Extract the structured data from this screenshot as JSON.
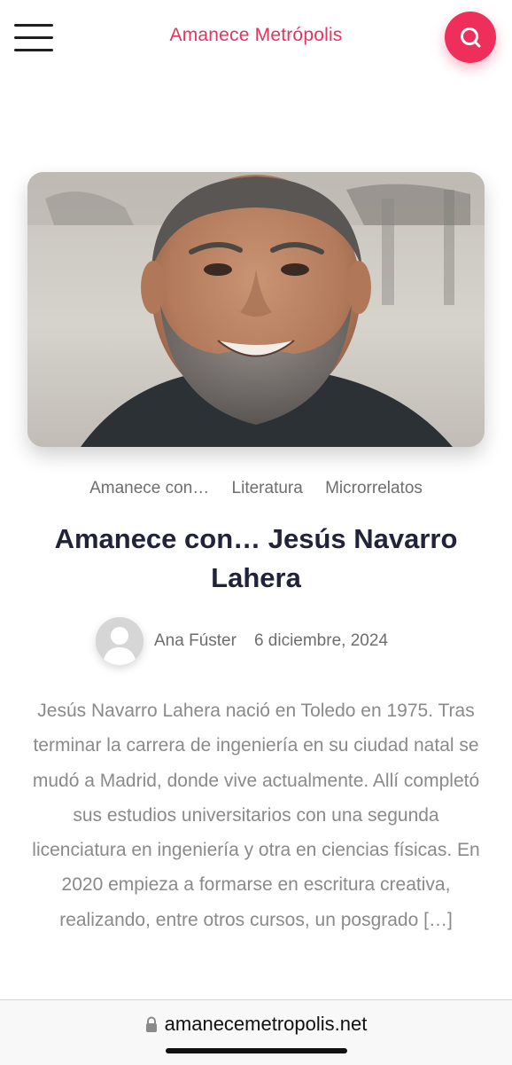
{
  "header": {
    "site_title": "Amanece Metrópolis",
    "menu_icon": "hamburger-menu-icon",
    "search_icon": "search-icon"
  },
  "colors": {
    "accent": "#ee2f5b",
    "title_text": "#22223a",
    "meta_text": "#6e6e6e",
    "excerpt_text": "#8a8a8a"
  },
  "post": {
    "image_subject": "author-portrait-photo",
    "categories": [
      "Amanece con…",
      "Literatura",
      "Microrrelatos"
    ],
    "title": "Amanece con… Jesús Navarro Lahera",
    "author": "Ana Fúster",
    "date": "6 diciembre, 2024",
    "excerpt": "Jesús Navarro Lahera nació en Toledo en 1975. Tras terminar la carrera de ingeniería en su ciudad natal se mudó a Madrid, donde vive actualmente. Allí completó sus estudios universitarios con una segunda licenciatura en ingeniería y otra en ciencias físicas. En 2020 empieza a formarse en escritura creativa, realizando, entre otros cursos, un posgrado […]"
  },
  "browser": {
    "url": "amanecemetropolis.net",
    "lock_icon": "lock-icon"
  }
}
